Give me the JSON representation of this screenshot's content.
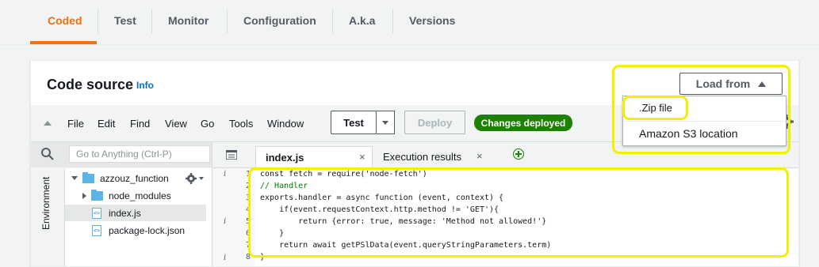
{
  "tabs": [
    {
      "label": "Coded"
    },
    {
      "label": "Test"
    },
    {
      "label": "Monitor"
    },
    {
      "label": "Configuration"
    },
    {
      "label": "A.k.a"
    },
    {
      "label": "Versions"
    }
  ],
  "panel": {
    "title": "Code source",
    "info": "Info",
    "load_from": "Load from"
  },
  "dropdown": {
    "items": [
      ".Zip file",
      "Amazon S3 location"
    ]
  },
  "menubar": {
    "items": [
      "File",
      "Edit",
      "Find",
      "View",
      "Go",
      "Tools",
      "Window"
    ],
    "test_label": "Test",
    "deploy_label": "Deploy",
    "status": "Changes deployed"
  },
  "sidebar": {
    "search_placeholder": "Go to Anything (Ctrl-P)",
    "environment_label": "Environment",
    "tree": [
      {
        "name": "azzouz_function"
      },
      {
        "name": "node_modules"
      },
      {
        "name": "index.js"
      },
      {
        "name": "package-lock.json"
      }
    ]
  },
  "editor": {
    "tabs": [
      "index.js",
      "Execution results"
    ],
    "lines": [
      "const fetch = require('node-fetch')",
      "// Handler",
      "exports.handler = async function (event, context) {",
      "    if(event.requestContext.http.method != 'GET'){",
      "        return {error: true, message: 'Method not allowed!'}",
      "    }",
      "    return await getPSlData(event.queryStringParameters.term)",
      "}"
    ],
    "line_numbers": [
      "1",
      "2",
      "3",
      "4",
      "5",
      "6",
      "7",
      "8"
    ]
  },
  "colors": {
    "accent": "#ec7211",
    "link": "#0073bb",
    "success": "#1d8102",
    "highlight": "#f2f000"
  }
}
